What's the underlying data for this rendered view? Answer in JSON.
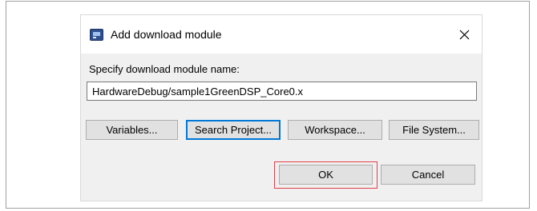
{
  "dialog": {
    "title": "Add download module",
    "close_symbol": "✕",
    "prompt": "Specify download module name:",
    "module_name_value": "HardwareDebug/sample1GreenDSP_Core0.x"
  },
  "buttons": {
    "variables": "Variables...",
    "search_project": "Search Project...",
    "workspace": "Workspace...",
    "file_system": "File System...",
    "ok": "OK",
    "cancel": "Cancel"
  },
  "icons": {
    "app": "app-window-icon",
    "close": "close-icon"
  },
  "colors": {
    "focus_border": "#0078d7",
    "highlight_box": "#e0404a"
  }
}
